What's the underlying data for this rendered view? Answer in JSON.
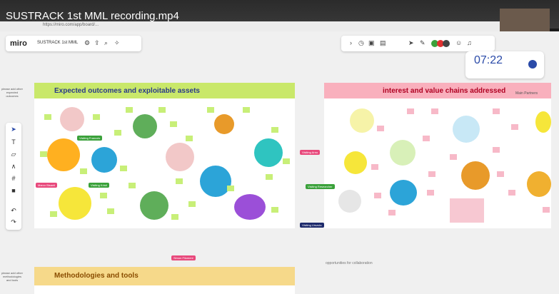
{
  "video": {
    "title": "SUSTRACK 1st MML recording.mp4"
  },
  "browser": {
    "url": "https://miro.com/app/board/..."
  },
  "miro": {
    "logo": "miro",
    "board_name": "SUSTRACK 1st MML"
  },
  "timer": {
    "value": "07:22"
  },
  "frames": [
    {
      "title": "Expected outcomes and exploitable assets",
      "color": "#c9e86a"
    },
    {
      "title": "interest and value chains addressed",
      "sub": "Main Partners",
      "color": "#f9b0bd"
    },
    {
      "title": "Methodologies and tools",
      "color": "#f6d98a"
    }
  ],
  "opportunities_label": "opportunities for collaboration",
  "cursor_tags": [
    {
      "label": "Visiting Francois",
      "color": "#3aa13a"
    },
    {
      "label": "Visiting Kristi",
      "color": "#3aa13a"
    },
    {
      "label": "Marco Bisanti",
      "color": "#e8497c"
    },
    {
      "label": "Visiting Researcher",
      "color": "#3aa13a"
    },
    {
      "label": "Visiting Arno",
      "color": "#e8497c"
    },
    {
      "label": "Visiting Urszula",
      "color": "#1d2a6b"
    },
    {
      "label": "Simon Filomeni",
      "color": "#e8497c"
    }
  ],
  "side_labels": [
    {
      "text": "please add other expected outcomes"
    },
    {
      "text": "please add other methodologies and tools"
    }
  ],
  "icons": [
    "settings-icon",
    "upload-icon",
    "search-icon",
    "reactions-icon",
    "cursor-icon",
    "text-icon",
    "sticky-icon",
    "pen-icon",
    "frame-icon",
    "more-icon",
    "undo-icon",
    "redo-icon",
    "play-icon",
    "timer-icon"
  ]
}
